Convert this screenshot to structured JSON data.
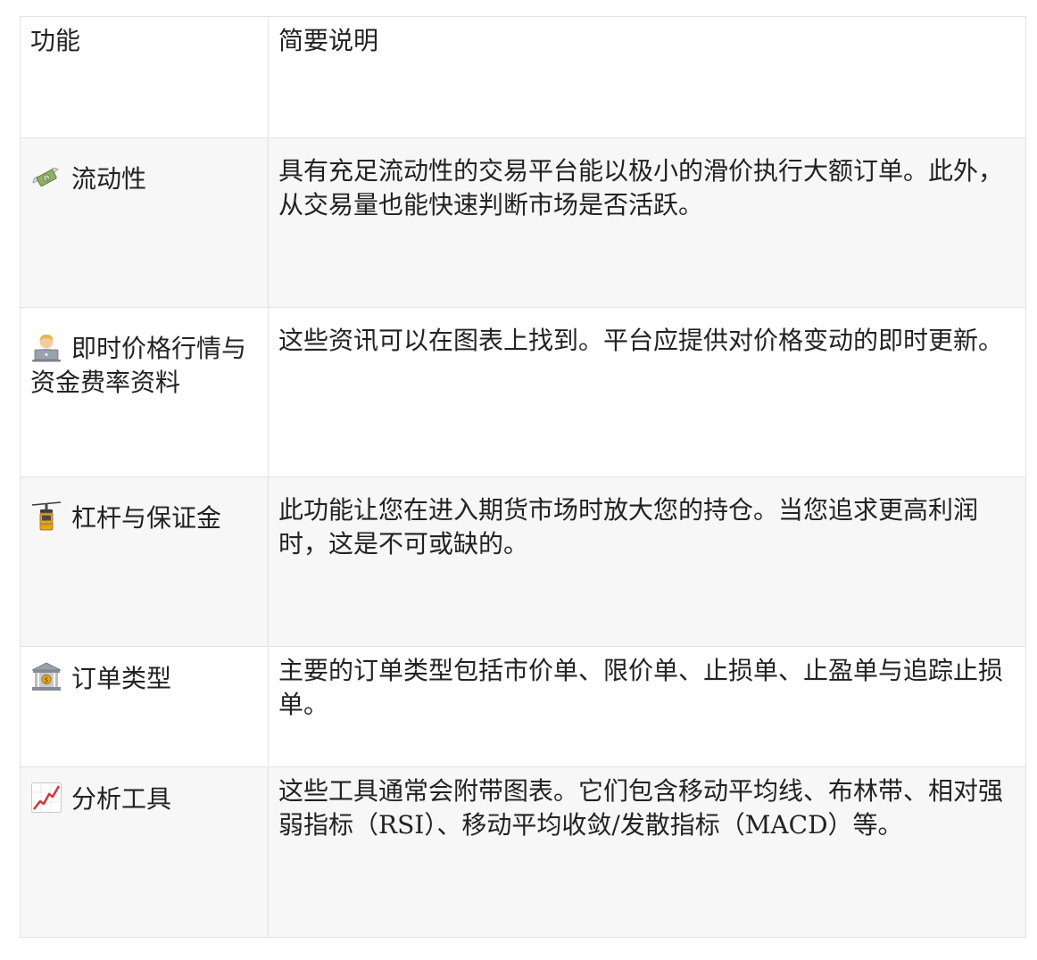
{
  "table": {
    "header": {
      "feature": "功能",
      "description": "简要说明"
    },
    "rows": [
      {
        "icon": "money-with-wings-icon",
        "feature": "流动性",
        "description": "具有充足流动性的交易平台能以极小的滑价执行大额订单。此外，从交易量也能快速判断市场是否活跃。"
      },
      {
        "icon": "technologist-icon",
        "feature": "即时价格行情与资金费率资料",
        "description": "这些资讯可以在图表上找到。平台应提供对价格变动的即时更新。"
      },
      {
        "icon": "aerial-tramway-icon",
        "feature": "杠杆与保证金",
        "description": "此功能让您在进入期货市场时放大您的持仓。当您追求更高利润时，这是不可或缺的。"
      },
      {
        "icon": "bank-icon",
        "feature": "订单类型",
        "description": "主要的订单类型包括市价单、限价单、止损单、止盈单与追踪止损单。"
      },
      {
        "icon": "chart-increasing-icon",
        "feature": "分析工具",
        "description": "这些工具通常会附带图表。它们包含移动平均线、布林带、相对强弱指标（RSI）、移动平均收敛/发散指标（MACD）等。"
      }
    ]
  }
}
